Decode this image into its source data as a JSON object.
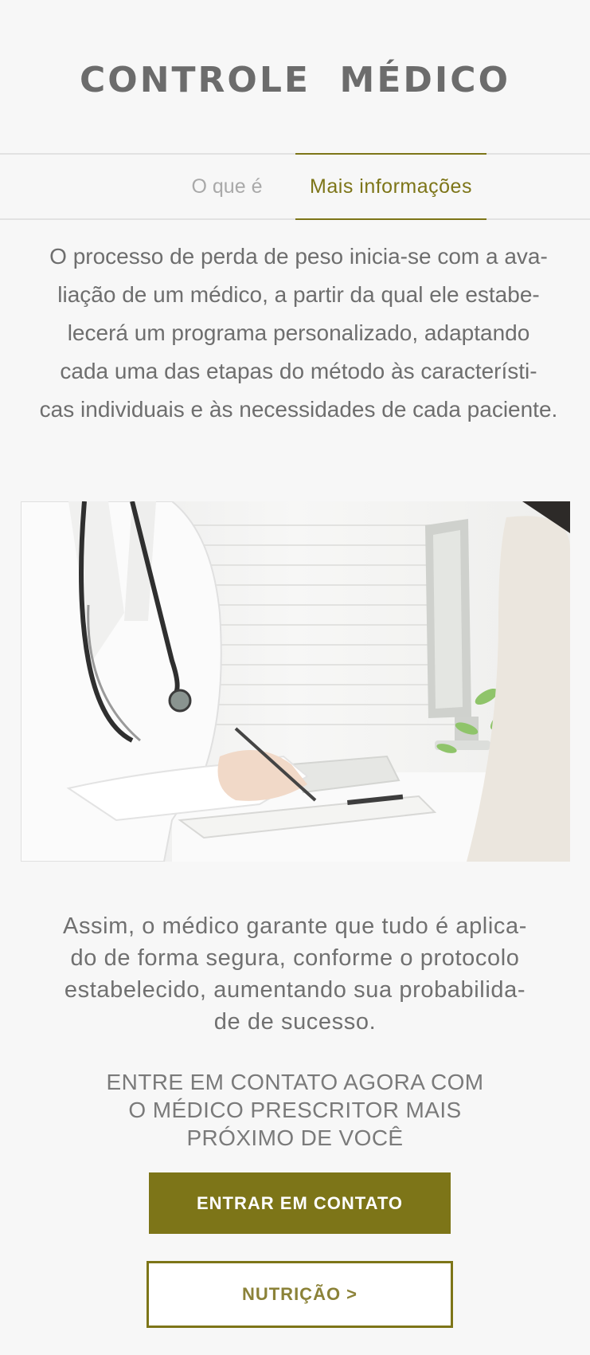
{
  "header": {
    "title": "CONTROLE  MÉDICO"
  },
  "tabs": [
    {
      "label": "O que é",
      "active": false
    },
    {
      "label": "Mais informações",
      "active": true
    }
  ],
  "intro_lines": [
    "O processo de perda de peso inicia-se com a ava-",
    "liação de um médico, a partir da qual ele estabe-",
    "lecerá um programa personalizado, adaptando",
    "cada uma das etapas do método às característi-",
    "cas individuais e às necessidades de cada paciente."
  ],
  "body_lines": [
    "Assim, o médico garante que tudo é aplica-",
    "do de forma segura, conforme o protocolo",
    "estabelecido, aumentando sua  probabilida-",
    "de de sucesso."
  ],
  "cta_lines": [
    "ENTRE EM CONTATO AGORA COM",
    "O MÉDICO PRESCRITOR MAIS",
    "PRÓXIMO DE VOCÊ"
  ],
  "buttons": {
    "contact": "ENTRAR EM CONTATO",
    "nutrition": "NUTRIÇÃO >"
  },
  "colors": {
    "accent": "#7d7518",
    "background": "#f7f7f7",
    "text": "#6e6e6e"
  }
}
